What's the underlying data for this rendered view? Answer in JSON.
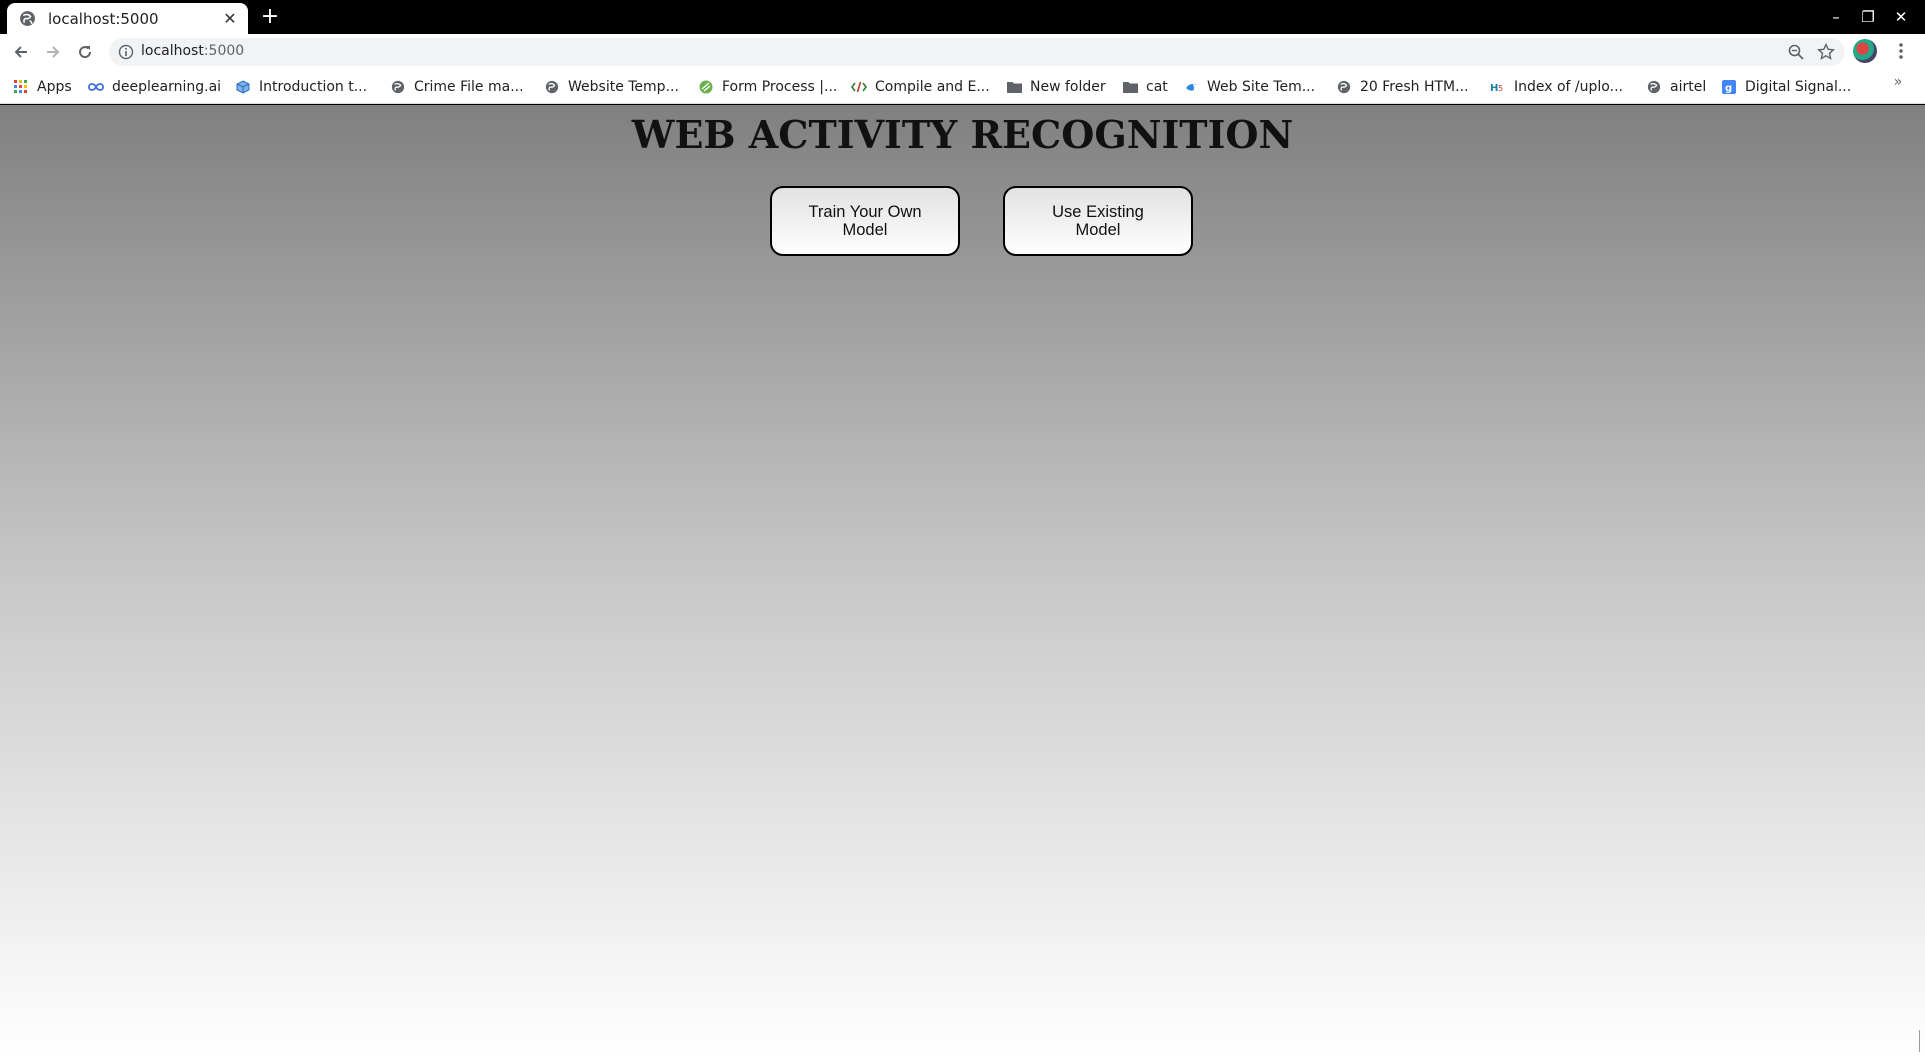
{
  "browser": {
    "tab": {
      "title": "localhost:5000",
      "close_glyph": "✕"
    },
    "new_tab_glyph": "+",
    "window_controls": {
      "minimize": "–",
      "maximize": "❐",
      "close": "✕"
    },
    "address": {
      "host": "localhost",
      "port": ":5000"
    },
    "bookmarks": [
      {
        "label": "Apps",
        "icon": "apps-grid-icon"
      },
      {
        "label": "deeplearning.ai",
        "icon": "infinity-icon"
      },
      {
        "label": "Introduction t...",
        "icon": "cube-icon"
      },
      {
        "label": "Crime File ma...",
        "icon": "globe-icon"
      },
      {
        "label": "Website Temp...",
        "icon": "globe-icon"
      },
      {
        "label": "Form Process |...",
        "icon": "green-circle-icon"
      },
      {
        "label": "Compile and E...",
        "icon": "code-icon"
      },
      {
        "label": "New folder",
        "icon": "folder-icon"
      },
      {
        "label": "cat",
        "icon": "folder-icon"
      },
      {
        "label": "Web Site Tem...",
        "icon": "bird-icon"
      },
      {
        "label": "20 Fresh HTM...",
        "icon": "globe-icon"
      },
      {
        "label": "Index of /uplo...",
        "icon": "hf-icon"
      },
      {
        "label": "airtel",
        "icon": "globe-icon"
      },
      {
        "label": "Digital Signal...",
        "icon": "google-icon"
      }
    ],
    "bookmarks_overflow": "»"
  },
  "page": {
    "title": "WEB ACTIVITY RECOGNITION",
    "buttons": [
      {
        "label": "Train Your Own Model"
      },
      {
        "label": "Use Existing Model"
      }
    ]
  }
}
